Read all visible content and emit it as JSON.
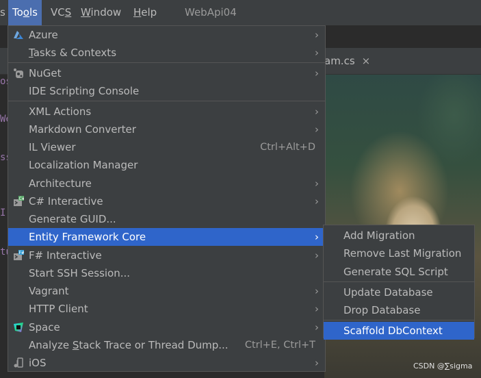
{
  "menubar": {
    "items": [
      {
        "label": "s"
      },
      {
        "label": "Tools"
      },
      {
        "label": "VCS"
      },
      {
        "label": "Window"
      },
      {
        "label": "Help"
      }
    ],
    "project_title": "WebApi04"
  },
  "editor": {
    "tab_label": "am.cs",
    "tab_close": "×",
    "gutter": [
      "os",
      "We",
      "ss",
      "I",
      "tu"
    ],
    "watermark": "CSDN @∑sigma"
  },
  "tools_menu": {
    "items": [
      {
        "label": "Azure",
        "icon": "azure-icon",
        "submenu": true
      },
      {
        "label": "Tasks & Contexts",
        "submenu": true
      },
      {
        "label": "NuGet",
        "icon": "nuget-icon",
        "submenu": true
      },
      {
        "label": "IDE Scripting Console"
      },
      {
        "label": "XML Actions",
        "submenu": true
      },
      {
        "label": "Markdown Converter",
        "submenu": true
      },
      {
        "label": "IL Viewer",
        "shortcut": "Ctrl+Alt+D"
      },
      {
        "label": "Localization Manager"
      },
      {
        "label": "Architecture",
        "submenu": true
      },
      {
        "label": "C# Interactive",
        "icon": "csharp-interactive-icon",
        "submenu": true
      },
      {
        "label": "Generate GUID..."
      },
      {
        "label": "Entity Framework Core",
        "submenu": true,
        "selected": true
      },
      {
        "label": "F# Interactive",
        "icon": "fsharp-interactive-icon",
        "submenu": true
      },
      {
        "label": "Start SSH Session..."
      },
      {
        "label": "Vagrant",
        "submenu": true
      },
      {
        "label": "HTTP Client",
        "submenu": true
      },
      {
        "label": "Space",
        "icon": "space-icon",
        "submenu": true
      },
      {
        "label": "Analyze Stack Trace or Thread Dump...",
        "shortcut": "Ctrl+E, Ctrl+T"
      },
      {
        "label": "iOS",
        "icon": "ios-icon",
        "submenu": true
      }
    ],
    "submenu_arrow": "›"
  },
  "ef_submenu": {
    "items": [
      {
        "label": "Add Migration"
      },
      {
        "label": "Remove Last Migration"
      },
      {
        "label": "Generate SQL Script"
      },
      {
        "label": "Update Database"
      },
      {
        "label": "Drop Database"
      },
      {
        "label": "Scaffold DbContext",
        "selected": true
      }
    ]
  },
  "colors": {
    "menu_bg": "#3c3f41",
    "selection": "#2f65ca",
    "text": "#bbbbbb"
  }
}
